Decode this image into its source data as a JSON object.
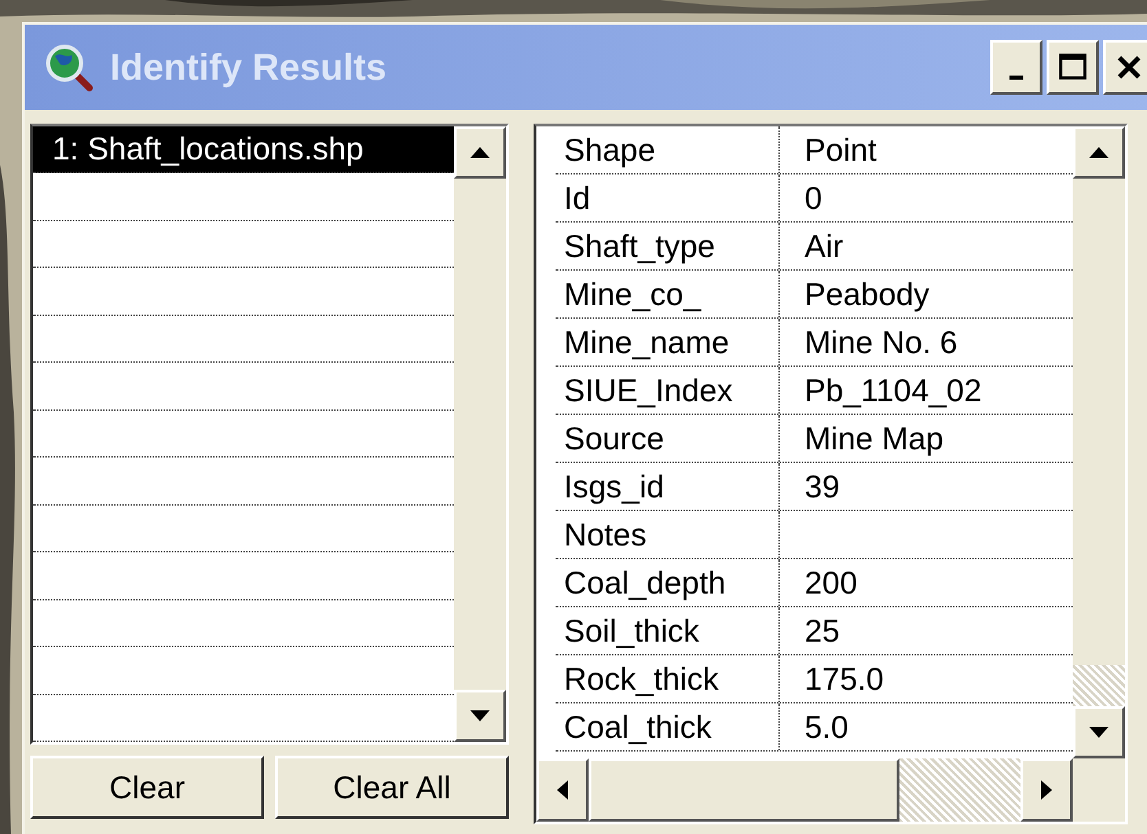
{
  "window": {
    "title": "Identify Results"
  },
  "results": [
    {
      "label": "1:  Shaft_locations.shp",
      "selected": true
    }
  ],
  "attributes": [
    {
      "field": "Shape",
      "value": "Point"
    },
    {
      "field": "Id",
      "value": "0"
    },
    {
      "field": "Shaft_type",
      "value": "Air"
    },
    {
      "field": "Mine_co_",
      "value": "Peabody"
    },
    {
      "field": "Mine_name",
      "value": "Mine No. 6"
    },
    {
      "field": "SIUE_Index",
      "value": "Pb_1104_02"
    },
    {
      "field": "Source",
      "value": "Mine Map"
    },
    {
      "field": "Isgs_id",
      "value": "39"
    },
    {
      "field": "Notes"
    },
    {
      "field": "Coal_depth",
      "value": "200"
    },
    {
      "field": "Soil_thick",
      "value": "25"
    },
    {
      "field": "Rock_thick",
      "value": "175.0"
    },
    {
      "field": "Coal_thick",
      "value": "5.0"
    }
  ],
  "buttons": [
    "Clear",
    "Clear All"
  ]
}
